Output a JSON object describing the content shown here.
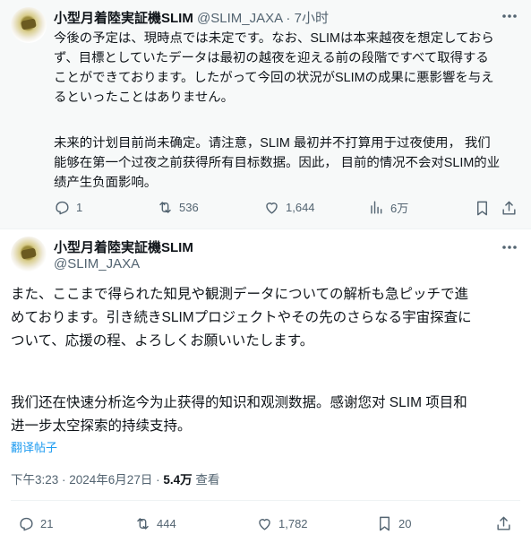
{
  "tweet1": {
    "name": "小型月着陸実証機SLIM",
    "handle_time": "@SLIM_JAXA · 7小时",
    "jp_lines": [
      "今後の予定は、現時点では未定です。なお、SLIMは本来越夜を想定しておら",
      "ず、目標としていたデータは最初の越夜を迎える前の段階ですべて取得する",
      "ことができております。したがって今回の状況がSLIMの成果に悪影響を与え",
      "るといったことはありません。"
    ],
    "zh_lines": [
      "未来的计划目前尚未确定。请注意，SLIM 最初并不打算用于过夜使用， 我们",
      "能够在第一个过夜之前获得所有目标数据。因此， 目前的情况不会对SLIM的业",
      "绩产生负面影响。"
    ],
    "replies": "1",
    "reposts": "536",
    "likes": "1,644",
    "views": "6万"
  },
  "tweet2": {
    "name": "小型月着陸実証機SLIM",
    "handle": "@SLIM_JAXA",
    "jp_lines": [
      "また、ここまで得られた知見や観測データについての解析も急ピッチで進",
      "めております。引き続きSLIMプロジェクトやその先のさらなる宇宙探査に",
      "ついて、応援の程、よろしくお願いいたします。"
    ],
    "zh_lines": [
      "我们还在快速分析迄今为止获得的知识和观测数据。感谢您对 SLIM 项目和",
      "进一步太空探索的持续支持。"
    ],
    "translate_label": "翻译帖子",
    "timestamp": "下午3:23 · 2024年6月27日 · ",
    "view_count": "5.4万",
    "views_label": " 查看",
    "replies": "21",
    "reposts": "444",
    "likes": "1,782",
    "bookmarks": "20"
  }
}
